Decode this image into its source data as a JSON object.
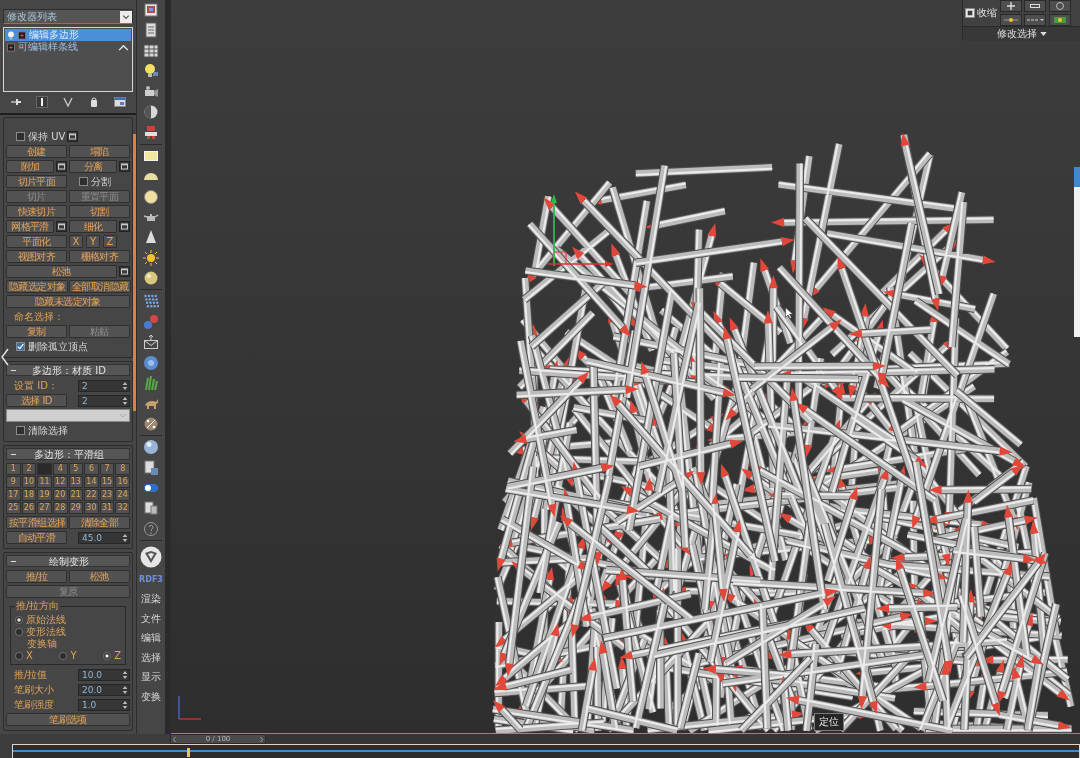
{
  "command_panel": {
    "modifier_list": {
      "value": "修改器列表"
    },
    "modifier_stack": [
      {
        "label": "编辑多边形",
        "selected": true
      },
      {
        "label": "可编辑样条线",
        "selected": false
      }
    ],
    "rollouts": [
      {
        "rows": [
          [
            {
              "kind": "checkbox",
              "label": "保持 UV",
              "checked": false,
              "settings": true
            }
          ],
          [
            {
              "kind": "button",
              "label": "创建",
              "disabled": false
            },
            {
              "kind": "button",
              "label": "塌陷",
              "disabled": false
            }
          ],
          [
            {
              "kind": "button",
              "label": "附加",
              "disabled": false,
              "settings": true
            },
            {
              "kind": "button",
              "label": "分离",
              "disabled": false,
              "settings": true
            }
          ],
          [
            {
              "kind": "button",
              "label": "切片平面",
              "disabled": false
            },
            {
              "kind": "checkbox",
              "label": "分割",
              "checked": false
            }
          ],
          [
            {
              "kind": "button",
              "label": "切片",
              "disabled": true
            },
            {
              "kind": "button",
              "label": "重置平面",
              "disabled": true
            }
          ],
          [
            {
              "kind": "button",
              "label": "快速切片",
              "disabled": false
            },
            {
              "kind": "button",
              "label": "切割",
              "disabled": false
            }
          ],
          [
            {
              "kind": "button",
              "label": "网格平滑",
              "disabled": false,
              "settings": true
            },
            {
              "kind": "button",
              "label": "细化",
              "disabled": false,
              "settings": true
            }
          ],
          [
            {
              "kind": "button",
              "label": "平面化",
              "disabled": false
            },
            {
              "kind": "axis_buttons",
              "labels": [
                "X",
                "Y",
                "Z"
              ]
            }
          ],
          [
            {
              "kind": "button",
              "label": "视图对齐",
              "disabled": false
            },
            {
              "kind": "button",
              "label": "栅格对齐",
              "disabled": false
            }
          ],
          [
            {
              "kind": "button",
              "label": "松弛",
              "disabled": false,
              "settings": true
            }
          ],
          [
            {
              "kind": "button",
              "label": "隐藏选定对象",
              "disabled": false
            },
            {
              "kind": "button",
              "label": "全部取消隐藏",
              "disabled": false
            }
          ],
          [
            {
              "kind": "button",
              "label": "隐藏未选定对象",
              "disabled": false
            }
          ],
          [
            {
              "kind": "label",
              "label": "命名选择："
            }
          ],
          [
            {
              "kind": "button",
              "label": "复制",
              "disabled": false
            },
            {
              "kind": "button",
              "label": "粘贴",
              "disabled": true
            }
          ],
          [
            {
              "kind": "checkbox",
              "label": "删除孤立顶点",
              "checked": true
            }
          ]
        ]
      },
      {
        "title": "多边形：材质 ID",
        "expanded": true,
        "rows": [
          [
            {
              "kind": "label",
              "label": "设置 ID："
            },
            {
              "kind": "spinner",
              "value": "2"
            }
          ],
          [
            {
              "kind": "button",
              "label": "选择 ID",
              "disabled": false
            },
            {
              "kind": "spinner",
              "value": "2"
            }
          ],
          [
            {
              "kind": "dropdown"
            }
          ],
          [
            {
              "kind": "checkbox",
              "label": "清除选择",
              "checked": false
            }
          ]
        ]
      },
      {
        "title": "多边形：平滑组",
        "expanded": true,
        "rows": [
          [
            {
              "kind": "grid",
              "groups": [
                {
                  "label": "1",
                  "selected": false
                },
                {
                  "label": "2",
                  "selected": false
                },
                {
                  "selected": true
                },
                {
                  "label": "4",
                  "selected": false
                },
                {
                  "label": "5",
                  "selected": false
                },
                {
                  "label": "6",
                  "selected": false
                },
                {
                  "label": "7",
                  "selected": false
                },
                {
                  "label": "8",
                  "selected": false
                },
                {
                  "label": "9",
                  "selected": false
                },
                {
                  "label": "10",
                  "selected": false
                },
                {
                  "label": "11",
                  "selected": false
                },
                {
                  "label": "12",
                  "selected": false
                },
                {
                  "label": "13",
                  "selected": false
                },
                {
                  "label": "14",
                  "selected": false
                },
                {
                  "label": "15",
                  "selected": false
                },
                {
                  "label": "16",
                  "selected": false
                },
                {
                  "label": "17",
                  "selected": false
                },
                {
                  "label": "18",
                  "selected": false
                },
                {
                  "label": "19",
                  "selected": false
                },
                {
                  "label": "20",
                  "selected": false
                },
                {
                  "label": "21",
                  "selected": false
                },
                {
                  "label": "22",
                  "selected": false
                },
                {
                  "label": "23",
                  "selected": false
                },
                {
                  "label": "24",
                  "selected": false
                },
                {
                  "label": "25",
                  "selected": false
                },
                {
                  "label": "26",
                  "selected": false
                },
                {
                  "label": "27",
                  "selected": false
                },
                {
                  "label": "28",
                  "selected": false
                },
                {
                  "label": "29",
                  "selected": false
                },
                {
                  "label": "30",
                  "selected": false
                },
                {
                  "label": "31",
                  "selected": false
                },
                {
                  "label": "32",
                  "selected": false
                }
              ]
            }
          ],
          [
            {
              "kind": "button",
              "label": "按平滑组选择",
              "disabled": false
            },
            {
              "kind": "button",
              "label": "清除全部",
              "disabled": false
            }
          ],
          [
            {
              "kind": "button",
              "label": "自动平滑",
              "disabled": false
            },
            {
              "kind": "spinner",
              "value": "45.0"
            }
          ]
        ]
      },
      {
        "title": "绘制变形",
        "expanded": true,
        "rows": [
          [
            {
              "kind": "button",
              "label": "推/拉",
              "disabled": false
            },
            {
              "kind": "button",
              "label": "松弛",
              "disabled": false
            }
          ],
          [
            {
              "kind": "button",
              "label": "复原",
              "disabled": true
            }
          ],
          [
            {
              "kind": "group",
              "title": "推/拉方向",
              "rows": [
                {
                  "kind": "radio",
                  "label": "原始法线",
                  "selected": true
                },
                {
                  "kind": "radio",
                  "label": "变形法线",
                  "selected": false
                },
                {
                  "kind": "label",
                  "label": "变换轴"
                },
                {
                  "kind": "radio_row",
                  "options": [
                    {
                      "label": "X",
                      "selected": false
                    },
                    {
                      "label": "Y",
                      "selected": false
                    },
                    {
                      "label": "Z",
                      "selected": true
                    }
                  ]
                }
              ]
            }
          ],
          [
            {
              "kind": "label",
              "label": "推/拉值"
            },
            {
              "kind": "spinner",
              "value": "10.0"
            }
          ],
          [
            {
              "kind": "label",
              "label": "笔刷大小"
            },
            {
              "kind": "spinner",
              "value": "20.0"
            }
          ],
          [
            {
              "kind": "label",
              "label": "笔刷强度"
            },
            {
              "kind": "spinner",
              "value": "1.0"
            }
          ],
          [
            {
              "kind": "button",
              "label": "笔刷选项",
              "disabled": false
            }
          ]
        ]
      }
    ]
  },
  "command_tabs": [
    {
      "label": "RDF3",
      "selected": true
    },
    {
      "label": "渲染",
      "selected": false
    },
    {
      "label": "文件",
      "selected": false
    },
    {
      "label": "编辑",
      "selected": false
    },
    {
      "label": "选择",
      "selected": false
    },
    {
      "label": "显示",
      "selected": false
    },
    {
      "label": "变换",
      "selected": false
    }
  ],
  "viewport": {
    "selection_panel": {
      "shrink_button": "收缩",
      "title": "修改选择"
    },
    "tooltip": "定位"
  },
  "timeline": {
    "time_slider": "0 / 100",
    "level": 0
  }
}
